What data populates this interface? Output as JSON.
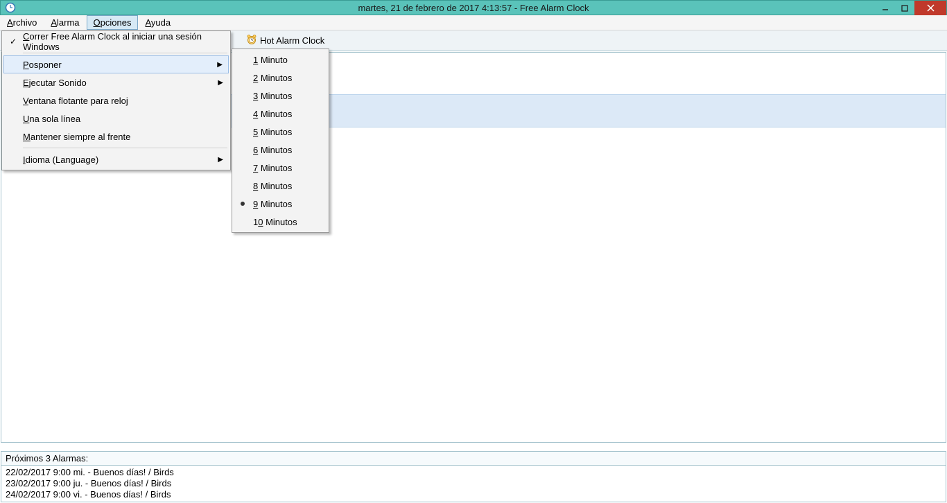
{
  "titlebar": {
    "title": "martes, 21 de febrero de 2017 4:13:57  -  Free Alarm Clock"
  },
  "menubar": {
    "items": [
      {
        "label": "Archivo",
        "ul": "A",
        "rest": "rchivo"
      },
      {
        "label": "Alarma",
        "ul": "A",
        "rest": "larma"
      },
      {
        "label": "Opciones",
        "ul": "O",
        "rest": "pciones"
      },
      {
        "label": "Ayuda",
        "ul": "A",
        "rest": "yuda"
      }
    ]
  },
  "toolbar": {
    "hot_label": "Hot Alarm Clock"
  },
  "options_menu": {
    "run_startup": "Correr Free Alarm Clock al iniciar una sesión Windows",
    "posponer": "Posponer",
    "ejecutar_sonido": "Ejecutar Sonido",
    "ventana_flotante": "Ventana flotante para reloj",
    "una_sola_linea": "Una sola línea",
    "mantener_frente": "Mantener siempre al frente",
    "idioma": "Idioma (Language)"
  },
  "posponer_sub": {
    "items": [
      "1 Minuto",
      "2 Minutos",
      "3 Minutos",
      "4 Minutos",
      "5 Minutos",
      "6 Minutos",
      "7 Minutos",
      "8 Minutos",
      "9 Minutos",
      "10 Minutos"
    ],
    "selected_index": 8
  },
  "status": {
    "title": "Próximos 3 Alarmas:",
    "lines": [
      "22/02/2017 9:00  mi.  - Buenos días! / Birds",
      "23/02/2017 9:00  ju.  - Buenos días! / Birds",
      "24/02/2017 9:00  vi.  - Buenos días! / Birds"
    ]
  },
  "underline_map": {
    "run_startup": "C",
    "posponer": "P",
    "ejecutar_sonido": "E",
    "ventana_flotante": "V",
    "una_sola_linea": "U",
    "mantener_frente": "M",
    "idioma": "I"
  }
}
